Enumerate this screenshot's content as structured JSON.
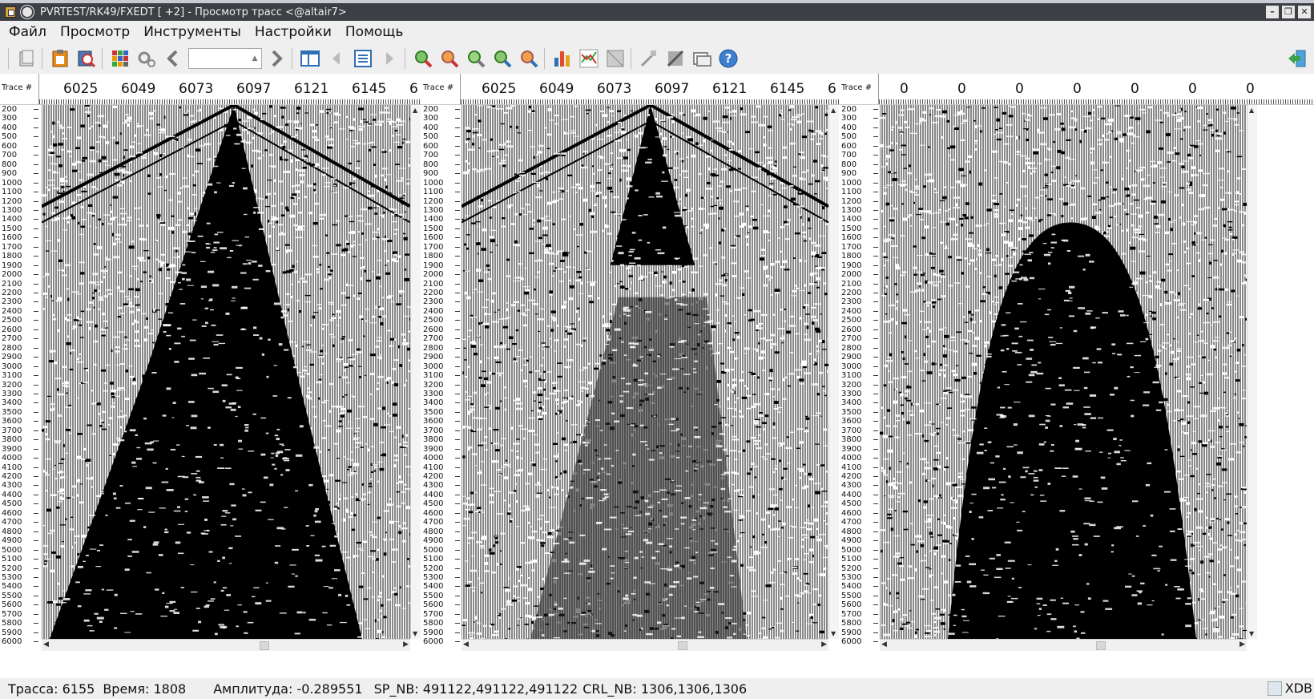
{
  "window": {
    "title": "PVRTEST/RK49/FXEDT [ +2] - Просмотр трасс <@altair7>"
  },
  "menu": [
    "Файл",
    "Просмотр",
    "Инструменты",
    "Настройки",
    "Помощь"
  ],
  "toolbar": {
    "combo_value": "",
    "icons": [
      "open-file-icon",
      "clipboard-icon",
      "zoom-document-icon",
      "color-grid-icon",
      "settings-icon",
      "back-arrow-icon",
      "forward-arrow-icon",
      "split-view-icon",
      "prev-icon",
      "list-icon",
      "next-icon",
      "zoom-in-icon",
      "zoom-out-icon",
      "zoom-fit-icon",
      "zoom-reset-icon",
      "zoom-select-icon",
      "bar-chart-icon",
      "line-chart-icon",
      "grid-chart-icon",
      "pick-icon",
      "edit-icon",
      "window-icon",
      "help-icon",
      "exit-icon"
    ]
  },
  "panels": [
    {
      "label": "Trace #",
      "ticks": [
        "6025",
        "6049",
        "6073",
        "6097",
        "6121",
        "6145",
        "6"
      ]
    },
    {
      "label": "Trace #",
      "ticks": [
        "6025",
        "6049",
        "6073",
        "6097",
        "6121",
        "6145",
        "6"
      ]
    },
    {
      "label": "Trace #",
      "ticks": [
        "0",
        "0",
        "0",
        "0",
        "0",
        "0",
        "0"
      ]
    }
  ],
  "time_axis": [
    "200",
    "300",
    "400",
    "500",
    "600",
    "700",
    "800",
    "900",
    "1000",
    "1100",
    "1200",
    "1300",
    "1400",
    "1500",
    "1600",
    "1700",
    "1800",
    "1900",
    "2000",
    "2100",
    "2200",
    "2300",
    "2400",
    "2500",
    "2600",
    "2700",
    "2800",
    "2900",
    "3000",
    "3100",
    "3200",
    "3300",
    "3400",
    "3500",
    "3600",
    "3700",
    "3800",
    "3900",
    "4000",
    "4100",
    "4200",
    "4300",
    "4400",
    "4500",
    "4600",
    "4700",
    "4800",
    "4900",
    "5000",
    "5100",
    "5200",
    "5300",
    "5400",
    "5500",
    "5600",
    "5700",
    "5800",
    "5900",
    "6000"
  ],
  "status": {
    "trace": "Трасса: 6155",
    "time": "Время: 1808",
    "amplitude": "Амплитуда: -0.289551",
    "sp_nb": "SP_NB: 491122,491122,491122",
    "crl_nb": "CRL_NB: 1306,1306,1306",
    "db": "XDB"
  }
}
